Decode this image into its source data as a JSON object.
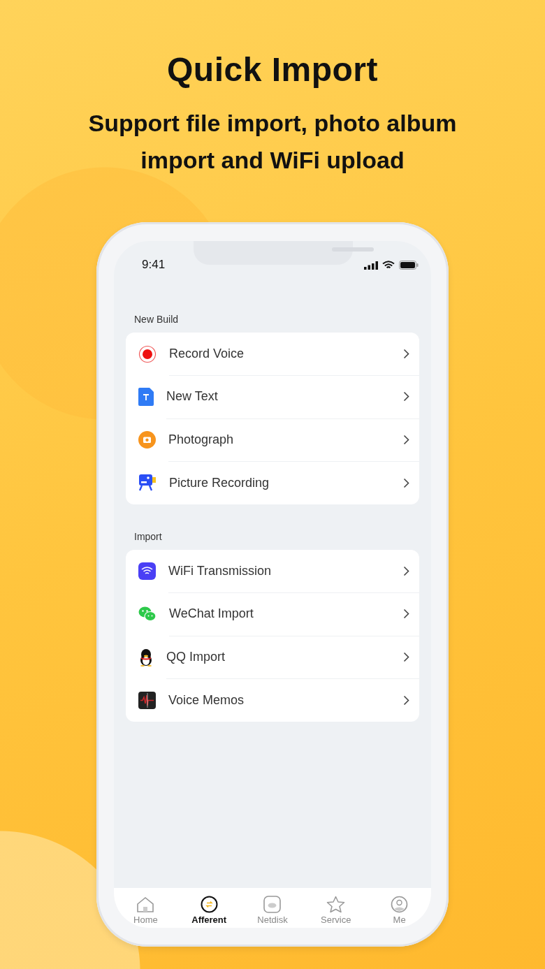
{
  "headline": "Quick Import",
  "subheadline": "Support file import, photo album import and WiFi upload",
  "phone": {
    "status_bar": {
      "time": "9:41"
    },
    "sections": [
      {
        "title": "New Build",
        "items": [
          {
            "label": "Record Voice"
          },
          {
            "label": "New Text"
          },
          {
            "label": "Photograph"
          },
          {
            "label": "Picture Recording"
          }
        ]
      },
      {
        "title": "Import",
        "items": [
          {
            "label": "WiFi Transmission"
          },
          {
            "label": "WeChat Import"
          },
          {
            "label": "QQ Import"
          },
          {
            "label": "Voice Memos"
          }
        ]
      }
    ],
    "tab_bar": [
      {
        "label": "Home",
        "selected": false
      },
      {
        "label": "Afferent",
        "selected": true
      },
      {
        "label": "Netdisk",
        "selected": false
      },
      {
        "label": "Service",
        "selected": false
      },
      {
        "label": "Me",
        "selected": false
      }
    ]
  }
}
